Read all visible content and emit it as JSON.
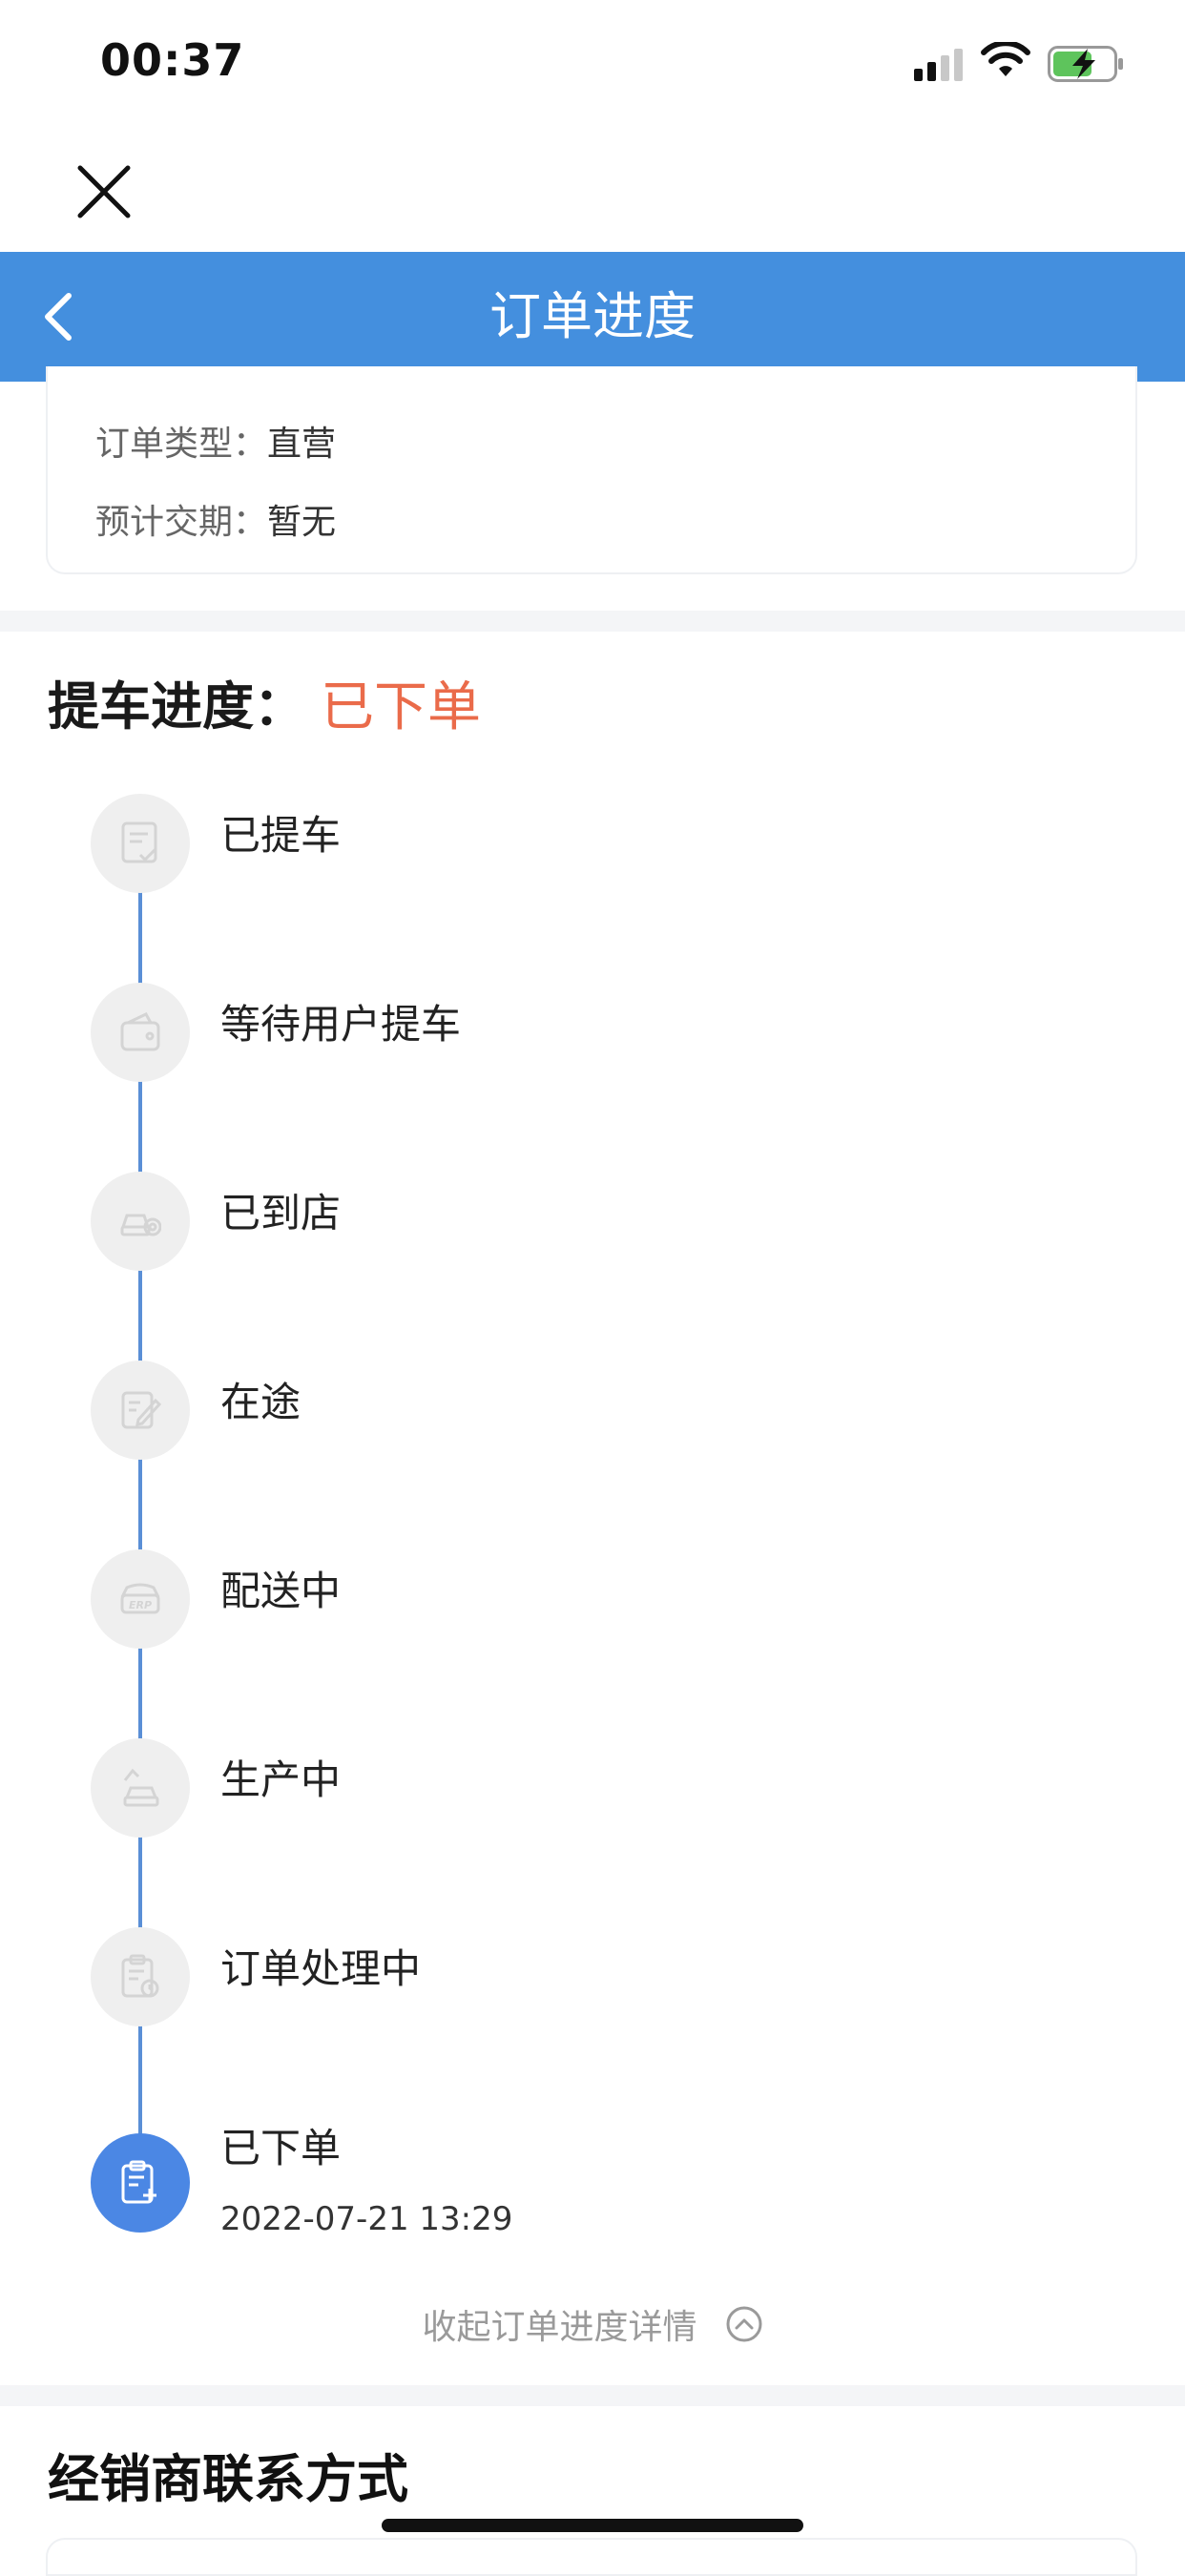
{
  "status_bar": {
    "time": "00:37"
  },
  "header": {
    "title": "订单进度"
  },
  "order_info": {
    "type_label": "订单类型：",
    "type_value": "直营",
    "delivery_label": "预计交期：",
    "delivery_value": "暂无"
  },
  "progress": {
    "heading": "提车进度：",
    "current_status": "已下单",
    "steps": [
      {
        "label": "已提车",
        "icon": "document-check-icon"
      },
      {
        "label": "等待用户提车",
        "icon": "wallet-icon"
      },
      {
        "label": "已到店",
        "icon": "car-shop-icon"
      },
      {
        "label": "在途",
        "icon": "edit-form-icon"
      },
      {
        "label": "配送中",
        "icon": "erp-truck-icon"
      },
      {
        "label": "生产中",
        "icon": "car-factory-icon"
      },
      {
        "label": "订单处理中",
        "icon": "clipboard-clock-icon"
      },
      {
        "label": "已下单",
        "icon": "clipboard-plus-icon",
        "time": "2022-07-21 13:29"
      }
    ],
    "collapse_label": "收起订单进度详情"
  },
  "dealer": {
    "heading": "经销商联系方式"
  },
  "colors": {
    "header_blue": "#448fde",
    "status_red": "#ea6b4a",
    "active_step": "#4b87e4",
    "inactive_step": "#efefef"
  }
}
